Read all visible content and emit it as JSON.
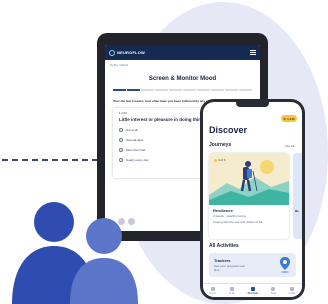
{
  "tablet": {
    "logo": "NEUROFLOW",
    "breadcrumb": "To Do  /  Mood",
    "title": "Screen & Monitor Mood",
    "progress": 0.2,
    "question": "Over the last 2 weeks, how often have you been bothered by any of the following problems?",
    "card": {
      "header": "1 of 10",
      "question": "Little interest or pleasure in doing things",
      "options": [
        "Not at all",
        "Several days",
        "More than half",
        "Nearly every day"
      ]
    }
  },
  "phone": {
    "title": "Discover",
    "badge": "1,240",
    "journeys": {
      "heading": "Journeys",
      "see_all": "See All",
      "card": {
        "tag": "4 of 6",
        "name": "Resilience",
        "meta": "2 weeks · Healthy Living",
        "desc": "Coping with the ups and downs of life"
      },
      "peek_label": "Re"
    },
    "all_activities": {
      "heading": "All Activities",
      "item": {
        "name": "Trackers",
        "desc": "See your progress over time"
      }
    },
    "tabs": [
      {
        "label": "Home",
        "active": false
      },
      {
        "label": "To Do",
        "active": false
      },
      {
        "label": "Discover",
        "active": true
      },
      {
        "label": "Data",
        "active": false
      },
      {
        "label": "Profile",
        "active": false
      }
    ]
  },
  "colors": {
    "header": "#152a52",
    "accent": "#2c4b8c",
    "background_blob": "#e6e8f6",
    "people_front": "#5b75c9",
    "people_back": "#2f4cb0",
    "badge": "#f6c343"
  }
}
